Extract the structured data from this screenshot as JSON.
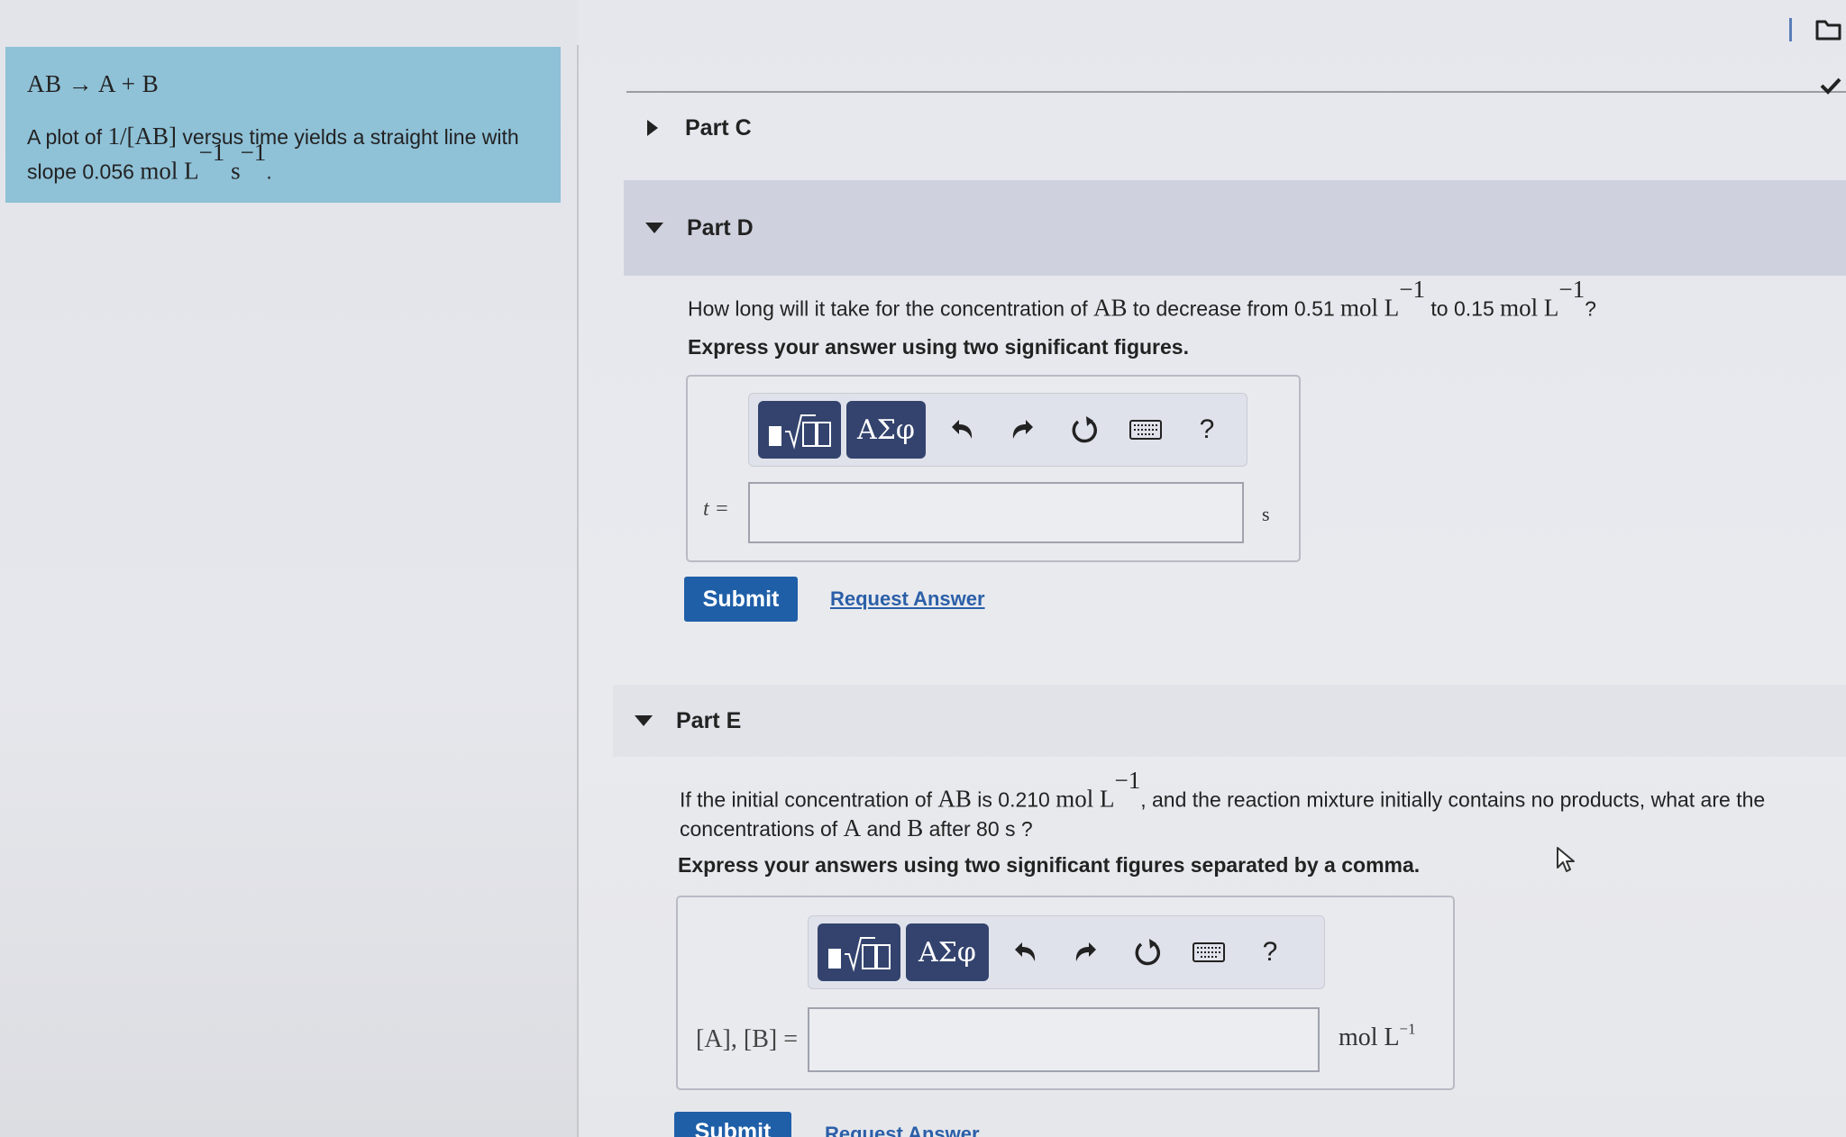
{
  "info": {
    "reaction": "AB → A + B",
    "text_pre": "A plot of ",
    "text_expr": "1/[AB]",
    "text_mid": " versus time yields a straight line with slope 0.056 ",
    "slope_unit_mol": "mol L",
    "slope_unit_exp1": "−1",
    "slope_unit_s": " s",
    "slope_unit_exp2": "−1",
    "text_end": "."
  },
  "parts": {
    "c": {
      "label": "Part C"
    },
    "d": {
      "label": "Part D",
      "q_pre": "How long will it take for the concentration of ",
      "q_species": "AB",
      "q_mid": " to decrease from 0.51 ",
      "q_unit1": "mol L",
      "q_exp1": "−1",
      "q_mid2": " to 0.15 ",
      "q_unit2": "mol L",
      "q_exp2": "−1",
      "q_end": "?",
      "instruction": "Express your answer using two significant figures.",
      "variable": "t =",
      "unit": "s",
      "input_value": "",
      "submit": "Submit",
      "request": "Request Answer"
    },
    "e": {
      "label": "Part E",
      "q_pre": "If the initial concentration of ",
      "q_species": "AB",
      "q_mid": " is 0.210 ",
      "q_unit": "mol L",
      "q_exp": "−1",
      "q_mid2": ", and the reaction mixture initially contains no products, what are the",
      "q_line2_pre": "concentrations of ",
      "q_a": "A",
      "q_and": " and ",
      "q_b": "B",
      "q_line2_end": " after 80  s ?",
      "instruction": "Express your answers using two significant figures separated by a comma.",
      "variable": "[A], [B] =",
      "unit_base": "mol L",
      "unit_exp": "−1",
      "input_value": "",
      "submit": "Submit",
      "request": "Request Answer"
    }
  },
  "toolbar": {
    "symbols_label": "ΑΣφ",
    "help_label": "?",
    "icons": [
      "templates-icon",
      "undo-icon",
      "redo-icon",
      "reset-icon",
      "keyboard-icon",
      "help-icon"
    ]
  },
  "colors": {
    "info_box": "#8fc1d7",
    "submit": "#1f5fa8",
    "toolbar_button": "#33436e",
    "link": "#2b5fa8"
  }
}
